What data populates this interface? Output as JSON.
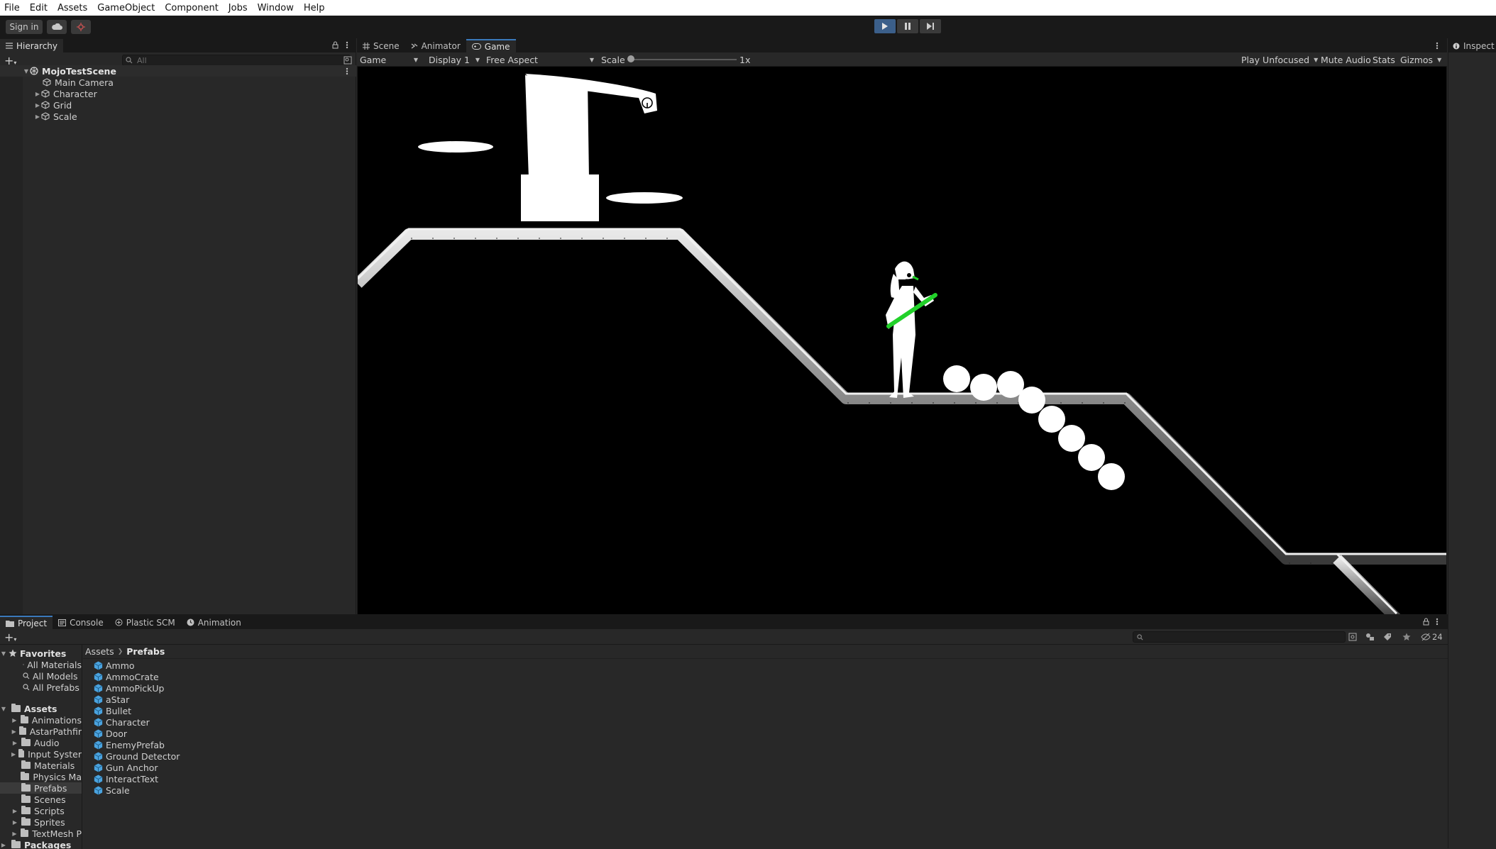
{
  "menu": [
    "File",
    "Edit",
    "Assets",
    "GameObject",
    "Component",
    "Jobs",
    "Window",
    "Help"
  ],
  "toolbar": {
    "sign_in": "Sign in"
  },
  "hierarchy": {
    "tab": "Hierarchy",
    "search_placeholder": "All",
    "scene": "MojoTestScene",
    "items": [
      "Main Camera",
      "Character",
      "Grid",
      "Scale"
    ]
  },
  "center_tabs": [
    "Scene",
    "Animator",
    "Game"
  ],
  "game_bar": {
    "mode": "Game",
    "display": "Display 1",
    "aspect": "Free Aspect",
    "scale_label": "Scale",
    "scale_value": "1x",
    "play_mode": "Play Unfocused",
    "mute": "Mute Audio",
    "stats": "Stats",
    "gizmos": "Gizmos"
  },
  "inspector": {
    "tab": "Inspect"
  },
  "bottom_tabs": [
    "Project",
    "Console",
    "Plastic SCM",
    "Animation"
  ],
  "project": {
    "hidden_count": "24",
    "favorites_label": "Favorites",
    "favorites": [
      "All Materials",
      "All Models",
      "All Prefabs"
    ],
    "assets_label": "Assets",
    "folders": [
      "Animations",
      "AstarPathfir",
      "Audio",
      "Input Syster",
      "Materials",
      "Physics Ma",
      "Prefabs",
      "Scenes",
      "Scripts",
      "Sprites",
      "TextMesh P"
    ],
    "packages_label": "Packages",
    "breadcrumb": [
      "Assets",
      "Prefabs"
    ],
    "prefabs": [
      "Ammo",
      "AmmoCrate",
      "AmmoPickUp",
      "aStar",
      "Bullet",
      "Character",
      "Door",
      "EnemyPrefab",
      "Ground Detector",
      "Gun Anchor",
      "InteractText",
      "Scale"
    ]
  },
  "colors": {
    "accent": "#3a79bb",
    "prefab_icon": "#4aa3df",
    "gun": "#22d12a"
  }
}
